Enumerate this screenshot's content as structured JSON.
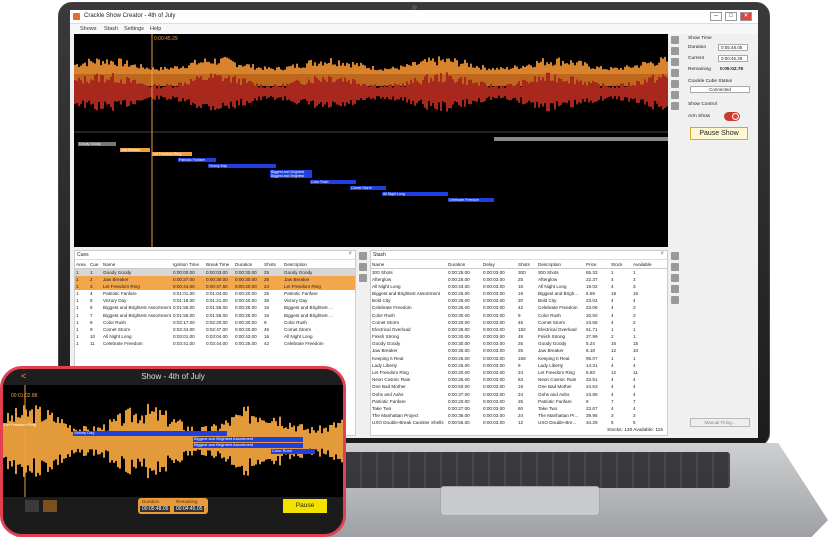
{
  "window": {
    "title": "Crackle Show Creator - 4th of July",
    "min": "–",
    "max": "□",
    "close": "✕"
  },
  "menu": [
    "Shows",
    "Stash",
    "Settings",
    "Help"
  ],
  "timeline": {
    "playhead": "0:00:45.29"
  },
  "timeline_cues": [
    {
      "label": "Goody Goody"
    },
    {
      "label": "Jaw Breaker"
    },
    {
      "label": "Let Freedom Ring"
    },
    {
      "label": "Patriotic Fanfare"
    },
    {
      "label": "Victory Day"
    },
    {
      "label": "Biggest and Brightest"
    },
    {
      "label": "Biggest and Brightest"
    },
    {
      "label": "Color Rush"
    },
    {
      "label": "Comet Storm"
    },
    {
      "label": "All Night Long"
    },
    {
      "label": "Celebrate Freedom"
    }
  ],
  "show_time": {
    "heading": "Show Time",
    "duration_label": "Duration",
    "duration": "0:05:48.05",
    "current_label": "Current",
    "current": "0:00:45.29",
    "remaining_label": "Remaining",
    "remaining": "0:05:02.76"
  },
  "cube_status": {
    "heading": "Crackle Cube Status",
    "value": "Connected"
  },
  "show_control": {
    "heading": "Show Control",
    "arm_label": "Arm Show",
    "pause_label": "Pause Show",
    "manual_label": "Manual Firing..."
  },
  "cues": {
    "title": "Cues",
    "columns": [
      "Area",
      "Cue",
      "Name",
      "Ignition Time",
      "Break Time",
      "Duration",
      "Shots",
      "Description"
    ],
    "rows": [
      [
        "1",
        "1",
        "Goody Goody",
        "0:00:00.00",
        "0:00:03.00",
        "0:00:30.00",
        "25",
        "Goody Goody"
      ],
      [
        "1",
        "2",
        "Jaw Breaker",
        "0:00:27.00",
        "0:00:30.00",
        "0:00:30.00",
        "25",
        "Jaw Breaker"
      ],
      [
        "1",
        "3",
        "Let Freedom Ring",
        "0:00:44.00",
        "0:00:47.50",
        "0:00:20.00",
        "24",
        "Let Freedom Ring"
      ],
      [
        "1",
        "4",
        "Patriotic Fanfare",
        "0:01:01.00",
        "0:01:04.00",
        "0:00:20.00",
        "25",
        "Patriotic Fanfare"
      ],
      [
        "1",
        "5",
        "Victory Day",
        "0:01:18.00",
        "0:01:21.00",
        "0:00:40.00",
        "36",
        "Victory Day"
      ],
      [
        "1",
        "6",
        "Biggest and Brightest Assortment",
        "0:01:55.00",
        "0:01:58.00",
        "0:00:25.00",
        "16",
        "Biggest and Brightest ..."
      ],
      [
        "1",
        "7",
        "Biggest and Brightest Assortment",
        "0:01:55.00",
        "0:01:58.00",
        "0:00:25.00",
        "16",
        "Biggest and Brightest ..."
      ],
      [
        "1",
        "8",
        "Color Rush",
        "0:02:17.00",
        "0:02:20.00",
        "0:00:30.00",
        "9",
        "Color Rush"
      ],
      [
        "1",
        "9",
        "Comet Storm",
        "0:02:44.00",
        "0:02:47.00",
        "0:00:20.00",
        "45",
        "Comet Storm"
      ],
      [
        "1",
        "10",
        "All Night Long",
        "0:03:01.00",
        "0:03:04.00",
        "0:00:43.00",
        "16",
        "All Night Long"
      ],
      [
        "1",
        "11",
        "Celebrate Freedom",
        "0:03:41.00",
        "0:03:44.00",
        "0:00:25.00",
        "42",
        "Celebrate Freedom"
      ]
    ]
  },
  "stash": {
    "title": "Stash",
    "columns": [
      "Name",
      "Duration",
      "Delay",
      "Shots",
      "Description",
      "Price",
      "Stock",
      "Available"
    ],
    "rows": [
      [
        "300 Shots",
        "0:00:25.00",
        "0:00:03.00",
        "300",
        "300 Shots",
        "65.33",
        "1",
        "1"
      ],
      [
        "Afterglow",
        "0:00:25.00",
        "0:00:03.00",
        "25",
        "Afterglow",
        "22.37",
        "4",
        "3"
      ],
      [
        "All Night Long",
        "0:00:43.00",
        "0:00:03.00",
        "16",
        "All Night Long",
        "19.02",
        "4",
        "3"
      ],
      [
        "Biggest and Brightest Assortment",
        "0:00:25.00",
        "0:00:03.00",
        "16",
        "Biggest and Brigh...",
        "5.59",
        "18",
        "16"
      ],
      [
        "Bold City",
        "0:00:25.00",
        "0:00:03.00",
        "20",
        "Bold City",
        "23.02",
        "4",
        "4"
      ],
      [
        "Celebrate Freedom",
        "0:00:25.00",
        "0:00:03.00",
        "42",
        "Celebrate Freedom",
        "23.06",
        "4",
        "3"
      ],
      [
        "Color Rush",
        "0:00:30.00",
        "0:00:03.00",
        "9",
        "Color Rush",
        "20.50",
        "4",
        "3"
      ],
      [
        "Comet Storm",
        "0:00:20.00",
        "0:00:03.00",
        "45",
        "Comet Storm",
        "23.55",
        "4",
        "2"
      ],
      [
        "Electrical Overload",
        "0:00:25.00",
        "0:00:03.00",
        "182",
        "Electrical Overload",
        "61.71",
        "1",
        "1"
      ],
      [
        "Finish Strong",
        "0:00:20.00",
        "0:00:03.00",
        "49",
        "Finish Strong",
        "27.99",
        "2",
        "1"
      ],
      [
        "Goody Goody",
        "0:00:30.00",
        "0:00:03.00",
        "25",
        "Goody Goody",
        "5.24",
        "16",
        "15"
      ],
      [
        "Jaw Breaker",
        "0:00:30.00",
        "0:00:03.00",
        "25",
        "Jaw Breaker",
        "6.18",
        "12",
        "10"
      ],
      [
        "Keeping It Real",
        "0:00:25.00",
        "0:00:03.00",
        "158",
        "Keeping It Real",
        "95.07",
        "1",
        "1"
      ],
      [
        "Lady Liberty",
        "0:00:25.00",
        "0:00:03.00",
        "9",
        "Lady Liberty",
        "14.31",
        "4",
        "4"
      ],
      [
        "Let Freedom Ring",
        "0:00:20.00",
        "0:00:03.00",
        "24",
        "Let Freedom Ring",
        "5.83",
        "12",
        "11"
      ],
      [
        "Neon Cosmic Rain",
        "0:00:25.00",
        "0:00:03.00",
        "63",
        "Neon Cosmic Rain",
        "33.51",
        "4",
        "4"
      ],
      [
        "One Bad Mother",
        "0:00:50.00",
        "0:00:03.00",
        "16",
        "One Bad Mother",
        "24.53",
        "4",
        "4"
      ],
      [
        "Oohs and Aahs",
        "0:00:37.00",
        "0:00:03.00",
        "24",
        "Oohs and Aahs",
        "23.88",
        "4",
        "4"
      ],
      [
        "Patriotic Fanfare",
        "0:00:20.00",
        "0:00:03.00",
        "25",
        "Patriotic Fanfare",
        "8",
        "7",
        "7"
      ],
      [
        "Take Two",
        "0:00:27.00",
        "0:00:03.00",
        "60",
        "Take Two",
        "23.67",
        "4",
        "4"
      ],
      [
        "The Manhattan Project",
        "0:00:36.00",
        "0:00:03.00",
        "24",
        "The Manhattan Pr...",
        "39.95",
        "3",
        "3"
      ],
      [
        "UXO Double-Break Canister Shells",
        "0:00:56.00",
        "0:00:03.00",
        "12",
        "UXO Double-Bre...",
        "34.29",
        "5",
        "5"
      ]
    ],
    "footer": "Stocks: 130   Available: 115"
  },
  "phone": {
    "back": "<",
    "title": "Show - 4th of July",
    "time": "00:01:02.88",
    "cues": [
      {
        "label": "Let Freedom Ring"
      },
      {
        "label": "Victory Day"
      },
      {
        "label": "Biggest and Brightest Assortment"
      },
      {
        "label": "Biggest and Brightest Assortment"
      },
      {
        "label": "Color Rush"
      }
    ],
    "duration_label": "Duration",
    "duration": "00:05:48.05",
    "remaining_label": "Remaining",
    "remaining": "00:04:45.05",
    "pause": "Pause"
  },
  "colors": {
    "orange": "#f0a040",
    "accent": "#1f3fe0",
    "record": "#e0443a"
  }
}
